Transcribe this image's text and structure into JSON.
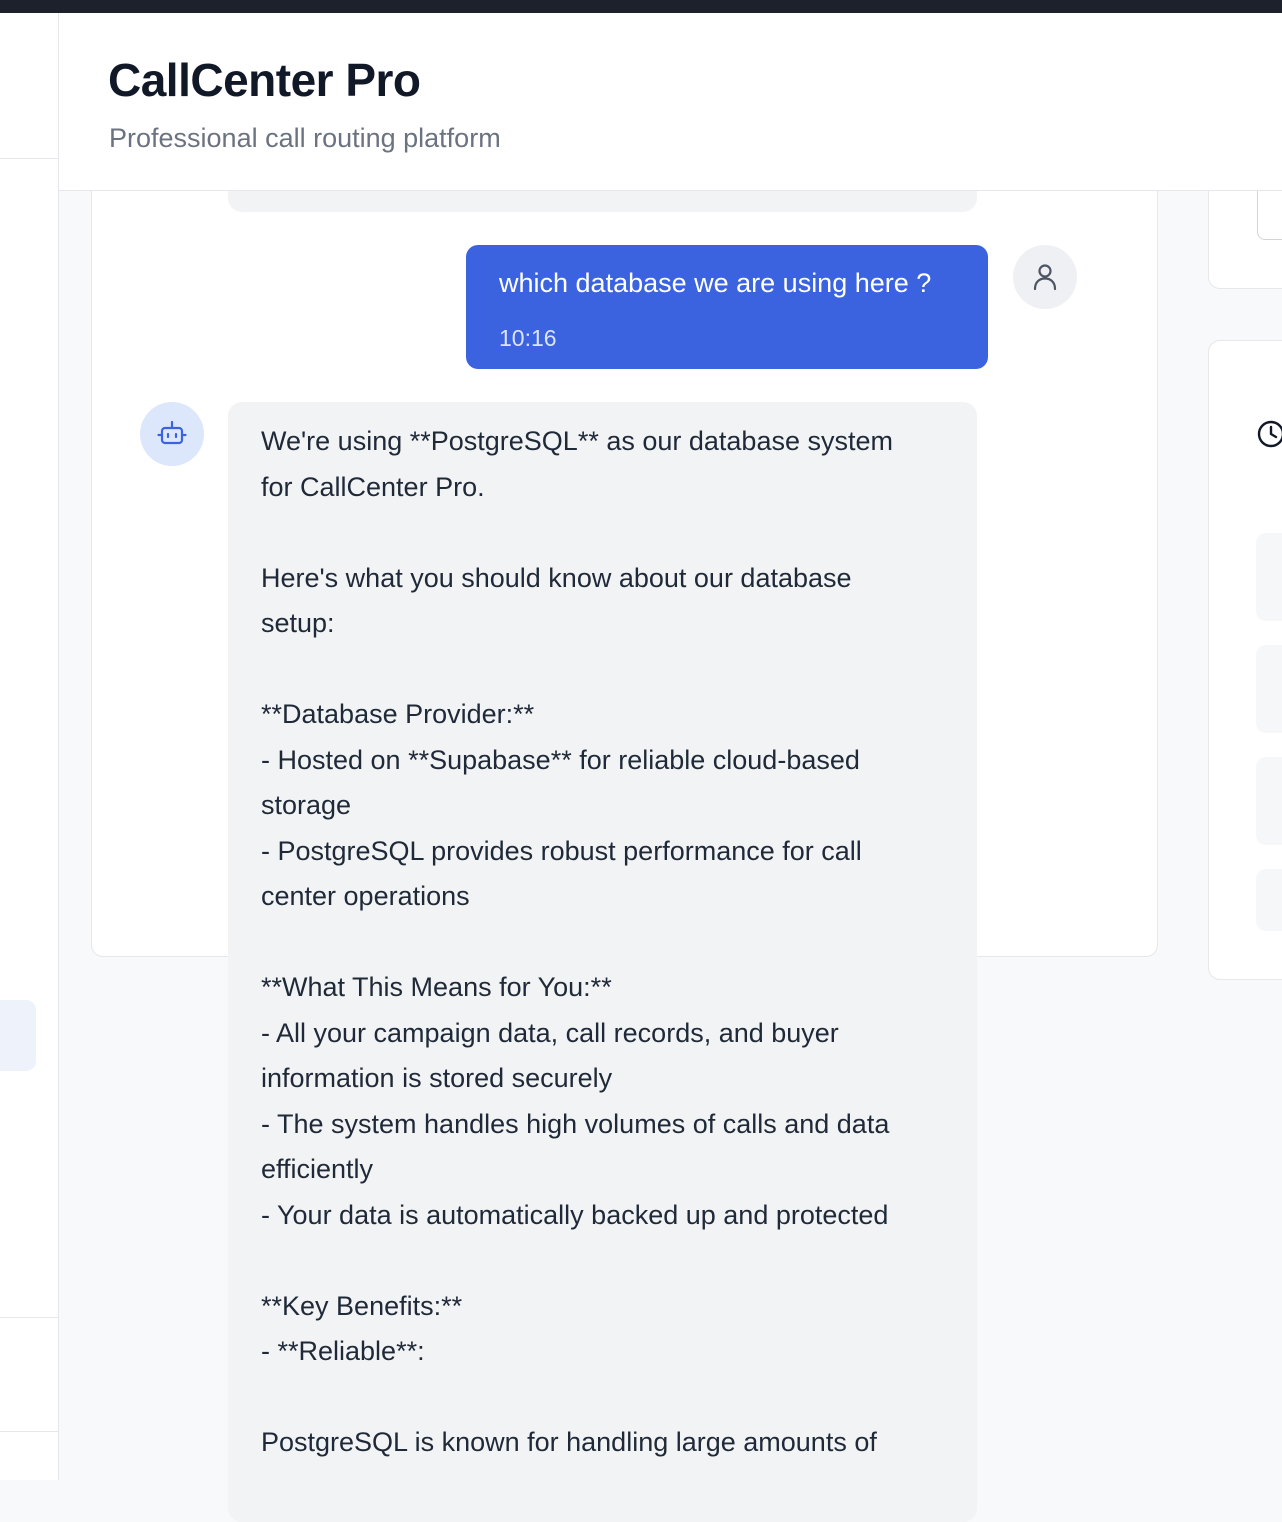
{
  "app": {
    "title": "CallCenter Pro",
    "subtitle": "Professional call routing platform"
  },
  "chat": {
    "user_message": {
      "text": "which database we are using here ?",
      "time": "10:16",
      "avatar_icon": "user-icon"
    },
    "assistant_message": {
      "avatar_icon": "bot-icon",
      "lines": [
        "We're using **PostgreSQL** as our database system",
        "for CallCenter Pro.",
        "",
        "Here's what you should know about our database",
        "setup:",
        "",
        "**Database Provider:**",
        "- Hosted on **Supabase** for reliable cloud-based",
        "storage",
        "- PostgreSQL provides robust performance for call",
        "center operations",
        "",
        "**What This Means for You:**",
        "- All your campaign data, call records, and buyer",
        "information is stored securely",
        "- The system handles high volumes of calls and data",
        "efficiently",
        "- Your data is automatically backed up and protected",
        "",
        "**Key Benefits:**",
        "- **Reliable**:",
        "",
        "PostgreSQL is known for handling large amounts of"
      ]
    }
  },
  "right_panel": {
    "clock_icon": "clock-icon"
  },
  "colors": {
    "accent": "#3b63e0",
    "bot_bubble": "#f2f3f5",
    "topbar": "#1c212b"
  }
}
